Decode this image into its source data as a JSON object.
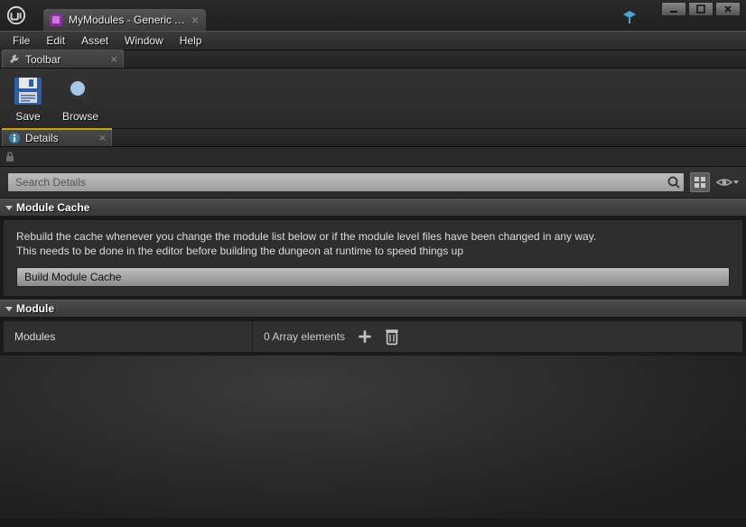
{
  "titlebar": {
    "doc_title": "MyModules - Generic Asset"
  },
  "menu": {
    "file": "File",
    "edit": "Edit",
    "asset": "Asset",
    "window": "Window",
    "help": "Help"
  },
  "tabs": {
    "toolbar": "Toolbar",
    "details": "Details"
  },
  "toolbar": {
    "save": "Save",
    "browse": "Browse"
  },
  "search": {
    "placeholder": "Search Details"
  },
  "module_cache": {
    "title": "Module Cache",
    "desc_line1": "Rebuild the cache whenever you change the module list below or if the module level files have been changed in any way.",
    "desc_line2": "This needs to be done in the editor before building the dungeon at runtime to speed things up",
    "button": "Build Module Cache"
  },
  "module": {
    "title": "Module",
    "prop_name": "Modules",
    "array_text": "0 Array elements"
  }
}
